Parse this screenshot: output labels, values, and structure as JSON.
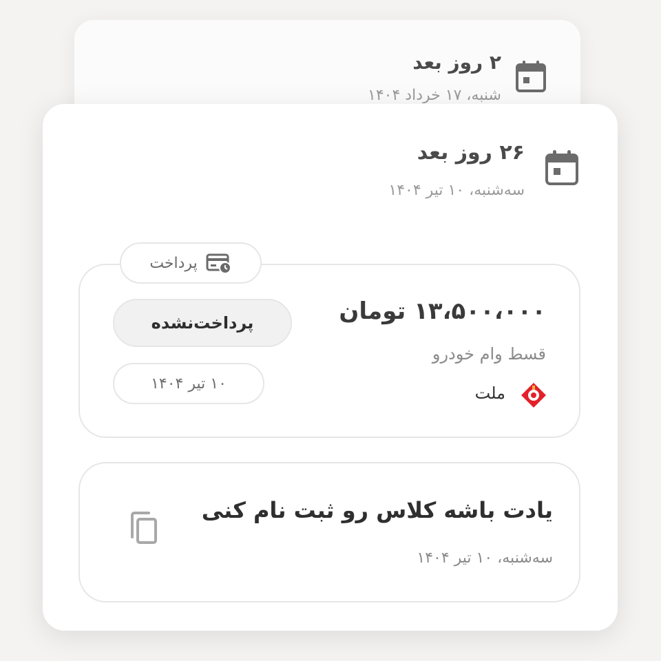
{
  "back_card": {
    "title": "۲ روز بعد",
    "date": "شنبه، ۱۷ خرداد ۱۴۰۴"
  },
  "event": {
    "title": "۲۶ روز بعد",
    "date": "سه‌شنبه، ۱۰ تیر ۱۴۰۴",
    "icon": "calendar-icon"
  },
  "payment": {
    "legend": "پرداخت",
    "legend_icon": "card-clock-icon",
    "amount": "۱۳،۵۰۰،۰۰۰ تومان",
    "description": "قسط وام خودرو",
    "bank": "ملت",
    "bank_icon": "bank-mellat-logo",
    "status": "پرداخت‌نشده",
    "due_date": "۱۰ تیر ۱۴۰۴"
  },
  "reminder": {
    "title": "یادت باشه کلاس رو ثبت نام کنی",
    "date": "سه‌شنبه، ۱۰ تیر ۱۴۰۴",
    "icon": "copy-icon"
  },
  "colors": {
    "background": "#f4f3f2",
    "card": "#ffffff",
    "border": "#e6e6e6",
    "bank_red": "#e3202b"
  }
}
